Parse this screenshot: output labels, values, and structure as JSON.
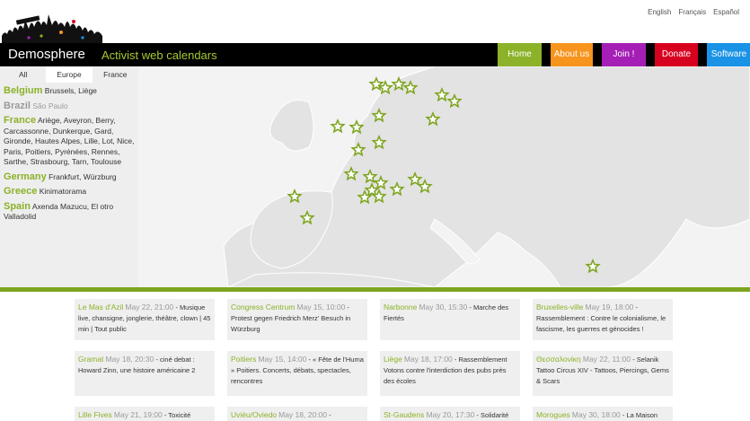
{
  "languages": [
    "English",
    "Français",
    "Español"
  ],
  "header": {
    "brand": "Demosphere",
    "tagline": "Activist web calendars"
  },
  "nav": [
    {
      "label": "Home",
      "color": "#8bb228"
    },
    {
      "label": "About us",
      "color": "#f7941d"
    },
    {
      "label": "Join !",
      "color": "#a51fb6"
    },
    {
      "label": "Donate",
      "color": "#d8001f"
    },
    {
      "label": "Software",
      "color": "#1a93e6"
    }
  ],
  "tabs": [
    "All",
    "Europe",
    "France"
  ],
  "countries": [
    {
      "name": "Belgium",
      "cities": "Brussels, Liège",
      "dim": false
    },
    {
      "name": "Brazil",
      "cities": "São Paulo",
      "dim": true
    },
    {
      "name": "France",
      "cities": "Ariège, Aveyron, Berry, Carcassonne, Dunkerque, Gard, Gironde, Hautes Alpes, Lille, Lot, Nice, Paris, Poitiers, Pyrénées, Rennes, Sarthe, Strasbourg, Tarn, Toulouse",
      "dim": false
    },
    {
      "name": "Germany",
      "cities": "Frankfurt, Würzburg",
      "dim": false
    },
    {
      "name": "Greece",
      "cities": "Kinimatorama",
      "dim": false
    },
    {
      "name": "Spain",
      "cities": "Axenda Mazucu, El otro Valladolid",
      "dim": false
    }
  ],
  "events": [
    {
      "place": "Le Mas d'Azil",
      "date": "May 22, 21:00",
      "text": "Musique live, chansigne, jonglerie, théâtre, clown | 45 min | Tout public"
    },
    {
      "place": "Congress Centrum",
      "date": "May 15, 10:00",
      "text": "Protest gegen Friedrich Merz' Besuch in Würzburg"
    },
    {
      "place": "Narbonne",
      "date": "May 30, 15:30",
      "text": "Marche des Fiertés"
    },
    {
      "place": "Bruxelles-ville",
      "date": "May 19, 18:00",
      "text": "Rassemblement : Contre le colonialisme, le fascisme, les guerres et génocides !"
    },
    {
      "place": "Gramat",
      "date": "May 18, 20:30",
      "text": "ciné debat : Howard Zinn, une histoire américaine 2"
    },
    {
      "place": "Poitiers",
      "date": "May 15, 14:00",
      "text": "« Fête de l'Huma » Poitiers. Concerts, débats, spectacles, rencontres"
    },
    {
      "place": "Liège",
      "date": "May 18, 17:00",
      "text": "Rassemblement Votons contre l'interdiction des pubs près des écoles"
    },
    {
      "place": "Θεσσαλονίκη",
      "date": "May 22, 11:00",
      "text": "Selanik Tattoo Circus XIV - Tattoos, Piercings, Gems & Scars"
    },
    {
      "place": "Lille Fives",
      "date": "May 21, 19:00",
      "text": "Toxicité"
    },
    {
      "place": "Uviéu/Oviedo",
      "date": "May 18, 20:00",
      "text": ""
    },
    {
      "place": "St-Gaudens",
      "date": "May 20, 17:30",
      "text": "Solidarité"
    },
    {
      "place": "Morogues",
      "date": "May 30, 18:00",
      "text": "La Maison"
    }
  ]
}
